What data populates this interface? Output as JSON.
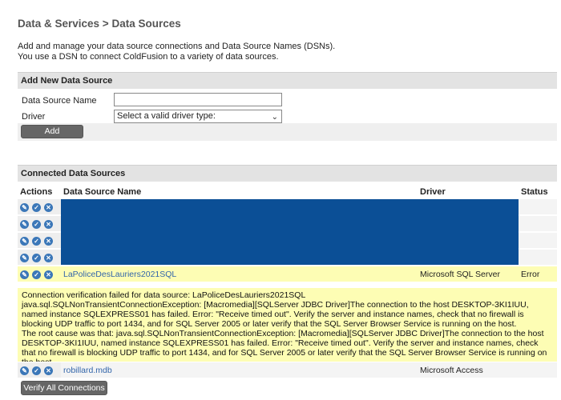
{
  "breadcrumb": "Data & Services > Data Sources",
  "intro": {
    "line1": "Add and manage your data source connections and Data Source Names (DSNs).",
    "line2": "You use a DSN to connect ColdFusion to a variety of data sources."
  },
  "add_section": {
    "title": "Add New Data Source",
    "name_label": "Data Source Name",
    "name_value": "",
    "driver_label": "Driver",
    "driver_selected": "Select a valid driver type:",
    "add_button": "Add"
  },
  "connected_section": {
    "title": "Connected Data Sources",
    "headers": {
      "actions": "Actions",
      "name": "Data Source Name",
      "driver": "Driver",
      "status": "Status"
    },
    "rows": [
      {
        "name": "LaPoliceDesLauriers2021SQL",
        "driver": "Microsoft SQL Server",
        "status": "Error"
      },
      {
        "name": "robillard.mdb",
        "driver": "Microsoft Access",
        "status": ""
      }
    ],
    "error_message": {
      "line1": "Connection verification failed for data source: LaPoliceDesLauriers2021SQL",
      "line2": "java.sql.SQLNonTransientConnectionException: [Macromedia][SQLServer JDBC Driver]The connection to the host DESKTOP-3KI1IUU, named instance SQLEXPRESS01 has failed. Error: \"Receive timed out\". Verify the server and instance names, check that no firewall is blocking UDP traffic to port 1434, and for SQL Server 2005 or later verify that the SQL Server Browser Service is running on the host.",
      "line3": "The root cause was that: java.sql.SQLNonTransientConnectionException: [Macromedia][SQLServer JDBC Driver]The connection to the host DESKTOP-3KI1IUU, named instance SQLEXPRESS01 has failed. Error: \"Receive timed out\". Verify the server and instance names, check that no firewall is blocking UDP traffic to port 1434, and for SQL Server 2005 or later verify that the SQL Server Browser Service is running on the host."
    },
    "verify_button": "Verify All Connections"
  },
  "icons": [
    "edit-icon",
    "verify-icon",
    "delete-icon"
  ],
  "colors": {
    "redacted_block": "#0b4f96",
    "error_highlight": "#fdfdb4",
    "link": "#3366aa",
    "button": "#666666"
  }
}
